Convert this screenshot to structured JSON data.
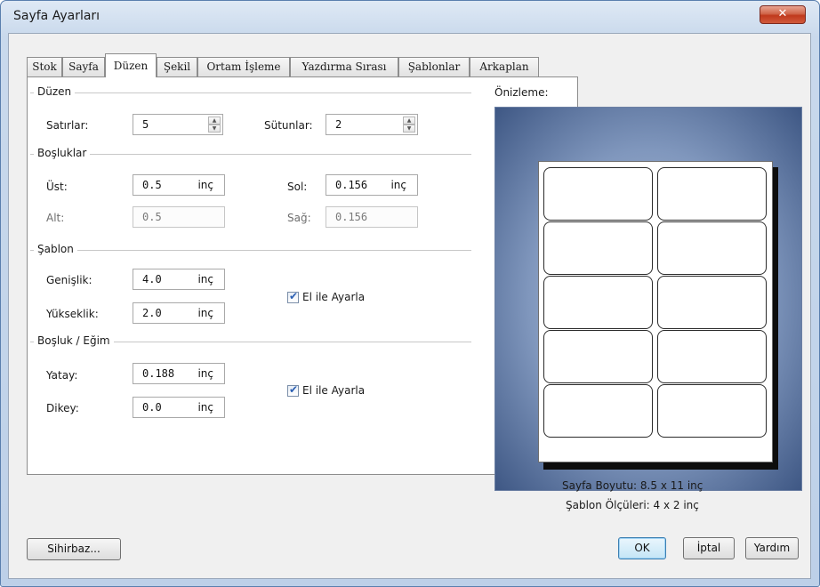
{
  "window": {
    "title": "Sayfa Ayarları"
  },
  "tabs": [
    {
      "label": "Stok"
    },
    {
      "label": "Sayfa"
    },
    {
      "label": "Düzen"
    },
    {
      "label": "Şekil"
    },
    {
      "label": "Ortam İşleme"
    },
    {
      "label": "Yazdırma Sırası"
    },
    {
      "label": "Şablonlar"
    },
    {
      "label": "Arkaplan"
    }
  ],
  "active_tab": "Düzen",
  "sections": {
    "duzen": {
      "title": "Düzen",
      "rows_label": "Satırlar:",
      "rows_value": "5",
      "cols_label": "Sütunlar:",
      "cols_value": "2"
    },
    "bosluklar": {
      "title": "Boşluklar",
      "top_label": "Üst:",
      "top_value": "0.5",
      "top_unit": "inç",
      "left_label": "Sol:",
      "left_value": "0.156",
      "left_unit": "inç",
      "bottom_label": "Alt:",
      "bottom_value": "0.5",
      "right_label": "Sağ:",
      "right_value": "0.156"
    },
    "sablon": {
      "title": "Şablon",
      "width_label": "Genişlik:",
      "width_value": "4.0",
      "width_unit": "inç",
      "height_label": "Yükseklik:",
      "height_value": "2.0",
      "height_unit": "inç",
      "manual_label": "El ile Ayarla",
      "manual_checked": true
    },
    "bosluk_egim": {
      "title": "Boşluk / Eğim",
      "horizontal_label": "Yatay:",
      "horizontal_value": "0.188",
      "horizontal_unit": "inç",
      "vertical_label": "Dikey:",
      "vertical_value": "0.0",
      "vertical_unit": "inç",
      "manual_label": "El ile Ayarla",
      "manual_checked": true
    }
  },
  "preview": {
    "title": "Önizleme:",
    "page_size_text": "Sayfa Boyutu:  8.5 x 11 inç",
    "template_size_text": "Şablon Ölçüleri:  4 x 2 inç",
    "grid": {
      "rows": 5,
      "cols": 2
    }
  },
  "buttons": {
    "wizard": "Sihirbaz...",
    "ok": "OK",
    "cancel": "İptal",
    "help": "Yardım"
  },
  "colors": {
    "accent": "#3c7fb1",
    "close": "#c0391c",
    "preview_bg": "#3e5784"
  },
  "icons": {
    "close": "close-icon",
    "spin": "spin-arrows-icon",
    "check": "checkmark-icon"
  }
}
